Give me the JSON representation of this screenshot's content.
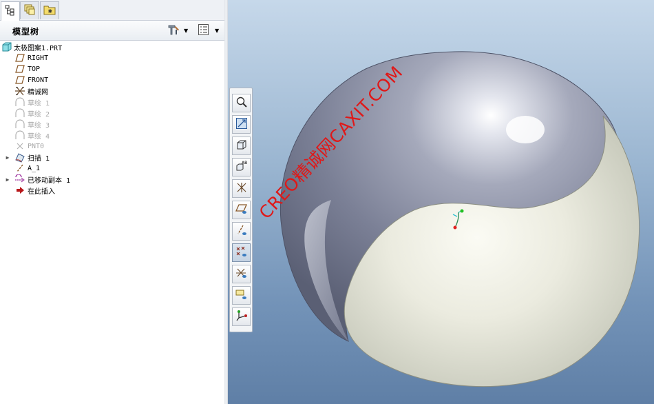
{
  "tabs": [
    {
      "icon": "model-tree-icon"
    },
    {
      "icon": "folder-browser-icon"
    },
    {
      "icon": "favorites-icon"
    }
  ],
  "panel": {
    "title": "模型树",
    "settings_icon": "settings-tools-icon",
    "show_icon": "tree-columns-icon"
  },
  "tree": [
    {
      "label": "太极图案1.PRT",
      "icon": "part-icon",
      "expand": "",
      "dim": false
    },
    {
      "label": "RIGHT",
      "icon": "datum-plane-icon",
      "expand": "",
      "dim": false
    },
    {
      "label": "TOP",
      "icon": "datum-plane-icon",
      "expand": "",
      "dim": false
    },
    {
      "label": "FRONT",
      "icon": "datum-plane-icon",
      "expand": "",
      "dim": false
    },
    {
      "label": "精诚网",
      "icon": "coordinate-system-icon",
      "expand": "",
      "dim": false
    },
    {
      "label": "草绘 1",
      "icon": "sketch-icon",
      "expand": "",
      "dim": true
    },
    {
      "label": "草绘 2",
      "icon": "sketch-icon",
      "expand": "",
      "dim": true
    },
    {
      "label": "草绘 3",
      "icon": "sketch-icon",
      "expand": "",
      "dim": true
    },
    {
      "label": "草绘 4",
      "icon": "sketch-icon",
      "expand": "",
      "dim": true
    },
    {
      "label": "PNT0",
      "icon": "datum-point-icon",
      "expand": "",
      "dim": true
    },
    {
      "label": "扫描 1",
      "icon": "sweep-icon",
      "expand": "▶",
      "dim": false
    },
    {
      "label": "A_1",
      "icon": "datum-axis-icon",
      "expand": "",
      "dim": false
    },
    {
      "label": "已移动副本 1",
      "icon": "moved-copy-icon",
      "expand": "▶",
      "dim": false
    },
    {
      "label": "在此插入",
      "icon": "insert-here-icon",
      "expand": "",
      "dim": false
    }
  ],
  "view_toolbar": [
    {
      "icon": "zoom-in-icon",
      "on": false
    },
    {
      "icon": "refit-icon",
      "on": false
    },
    {
      "icon": "shaded-view-icon",
      "on": false
    },
    {
      "icon": "saved-view-icon",
      "on": false
    },
    {
      "icon": "datum-display-icon",
      "on": false
    },
    {
      "icon": "plane-display-icon",
      "on": false
    },
    {
      "icon": "axis-display-icon",
      "on": false
    },
    {
      "icon": "point-display-icon",
      "on": true
    },
    {
      "icon": "csys-display-icon",
      "on": false
    },
    {
      "icon": "annotation-display-icon",
      "on": false
    },
    {
      "icon": "spin-center-icon",
      "on": false
    }
  ],
  "watermark": "CREO精诚网CAXIT.COM",
  "colors": {
    "dark_half": "#8a8fa4",
    "light_half": "#e6e6d9",
    "viewport_top": "#c6d8ea",
    "viewport_bottom": "#5f7fa6",
    "watermark": "#e01818"
  }
}
